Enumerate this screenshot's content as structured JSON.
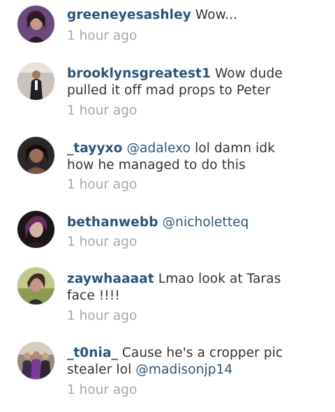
{
  "comments": [
    {
      "username": "greeneyesashley",
      "text_parts": [
        {
          "type": "text",
          "value": "Wow..."
        }
      ],
      "time": "1 hour ago",
      "avatar": "avatar-greeneyesashley"
    },
    {
      "username": "brooklynsgreatest1",
      "text_parts": [
        {
          "type": "text",
          "value": "Wow dude pulled it off mad props to Peter"
        }
      ],
      "time": "1 hour ago",
      "avatar": "avatar-brooklynsgreatest1"
    },
    {
      "username": "_tayyxo",
      "text_parts": [
        {
          "type": "mention",
          "value": "@adalexo"
        },
        {
          "type": "text",
          "value": "lol damn idk how he managed to do this"
        }
      ],
      "time": "1 hour ago",
      "avatar": "avatar-tayyxo"
    },
    {
      "username": "bethanwebb",
      "text_parts": [
        {
          "type": "mention",
          "value": "@nicholetteq"
        }
      ],
      "time": "1 hour ago",
      "avatar": "avatar-bethanwebb"
    },
    {
      "username": "zaywhaaaat",
      "text_parts": [
        {
          "type": "text",
          "value": "Lmao look at Taras face !!!!"
        }
      ],
      "time": "1 hour ago",
      "avatar": "avatar-zaywhaaaat"
    },
    {
      "username": "_t0nia_",
      "text_parts": [
        {
          "type": "text",
          "value": "Cause he's a cropper pic stealer lol"
        },
        {
          "type": "mention",
          "value": "@madisonjp14"
        }
      ],
      "time": "1 hour ago",
      "avatar": "avatar-t0nia"
    }
  ],
  "colors": {
    "username": "#2b5579",
    "mention": "#2b5579",
    "text": "#333333",
    "timestamp": "#a8a8a8",
    "background": "#ffffff"
  }
}
